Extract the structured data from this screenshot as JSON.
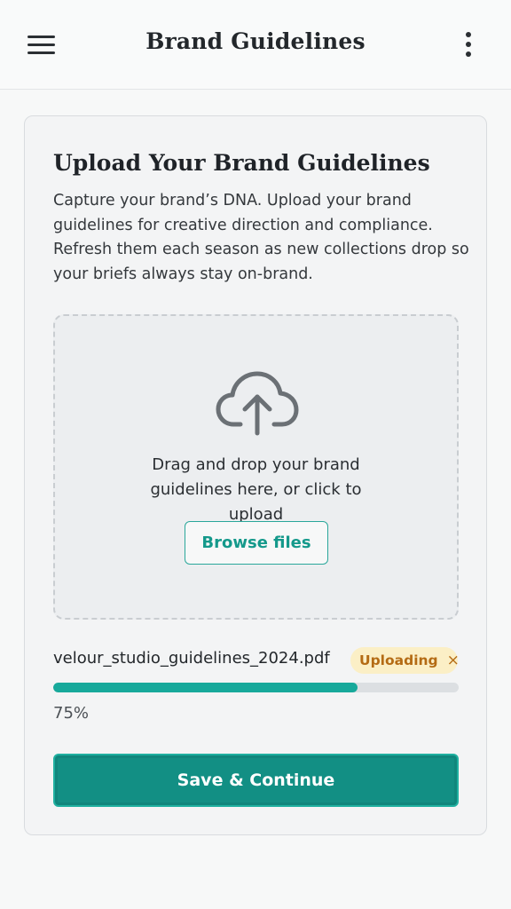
{
  "header": {
    "title": "Brand Guidelines",
    "menu_icon": "hamburger-menu-icon",
    "more_icon": "more-vertical-icon"
  },
  "card": {
    "title": "Upload Your Brand Guidelines",
    "description": "Capture your brand’s DNA. Upload your brand guidelines for creative direction and compliance. Refresh them each season as new collections drop so your briefs always stay on-brand."
  },
  "dropzone": {
    "icon": "cloud-upload-icon",
    "text": "Drag and drop your brand guidelines here, or click to upload",
    "browse_label": "Browse files"
  },
  "upload": {
    "file_name": "velour_studio_guidelines_2024.pdf",
    "status": "Uploading",
    "remove_icon": "×",
    "progress_percent": 75,
    "progress_label": "75%"
  },
  "actions": {
    "save_label": "Save & Continue"
  },
  "colors": {
    "accent": "#17a99b",
    "primary_button": "#128f84",
    "badge_bg": "#fbefc6",
    "badge_text": "#b46b14"
  }
}
